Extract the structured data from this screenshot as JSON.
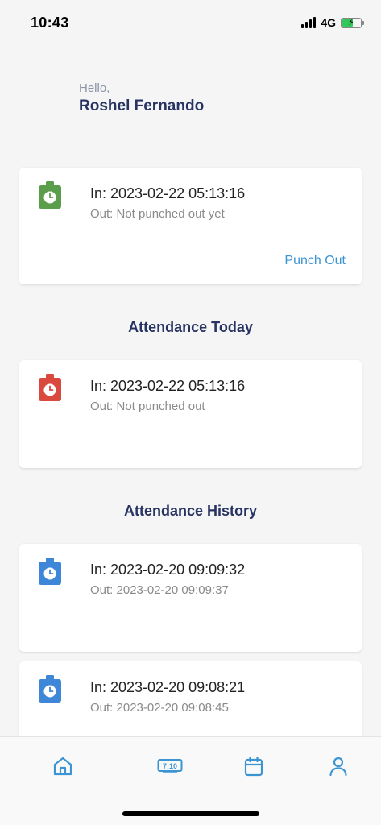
{
  "status_bar": {
    "time": "10:43",
    "network": "4G"
  },
  "greeting": {
    "hello": "Hello,",
    "name": "Roshel Fernando"
  },
  "current_punch": {
    "in": "In: 2023-02-22 05:13:16",
    "out": "Out: Not punched out yet",
    "action_label": "Punch Out",
    "icon": "punch-clock-icon",
    "icon_color": "#5a9e4b"
  },
  "today": {
    "title": "Attendance Today",
    "records": [
      {
        "in": "In: 2023-02-22 05:13:16",
        "out": "Out: Not punched out",
        "icon": "punch-clock-icon",
        "icon_color": "#d9493d"
      }
    ]
  },
  "history": {
    "title": "Attendance History",
    "records": [
      {
        "in": "In: 2023-02-20 09:09:32",
        "out": "Out: 2023-02-20 09:09:37",
        "icon": "punch-clock-icon",
        "icon_color": "#3e86d8"
      },
      {
        "in": "In: 2023-02-20 09:08:21",
        "out": "Out: 2023-02-20 09:08:45",
        "icon": "punch-clock-icon",
        "icon_color": "#3e86d8"
      }
    ]
  },
  "bottom_nav": {
    "items": [
      {
        "icon": "home-icon"
      },
      {
        "icon": "time-clock-icon",
        "text": "7:10"
      },
      {
        "icon": "calendar-icon"
      },
      {
        "icon": "profile-icon"
      }
    ],
    "color": "#3c94d2"
  }
}
